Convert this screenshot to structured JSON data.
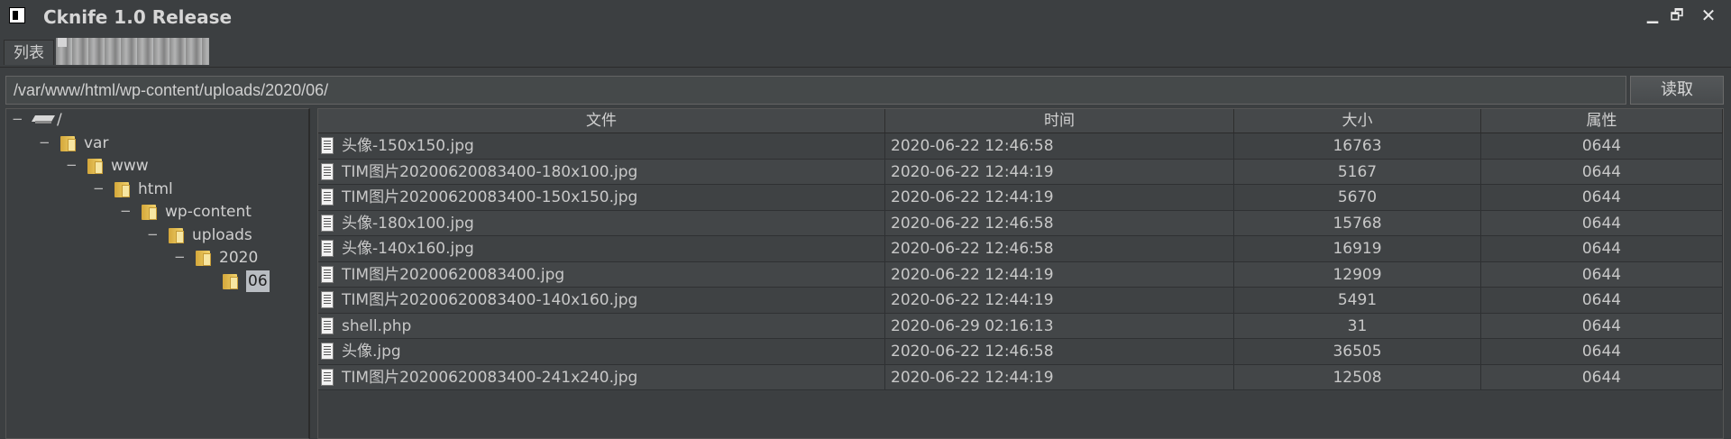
{
  "window": {
    "title": "Cknife 1.0 Release",
    "controls": {
      "minimize": "▁",
      "maximize": "🗗",
      "close": "✕"
    }
  },
  "tabs": [
    {
      "label": "列表"
    },
    {
      "label": ""
    }
  ],
  "pathbar": {
    "value": "/var/www/html/wp-content/uploads/2020/06/",
    "read_button": "读取"
  },
  "tree": {
    "nodes": [
      {
        "label": "/",
        "icon": "drive-icon",
        "toggle": "−",
        "depth": 0
      },
      {
        "label": "var",
        "icon": "folder-icon",
        "toggle": "−",
        "depth": 1
      },
      {
        "label": "www",
        "icon": "folder-icon",
        "toggle": "−",
        "depth": 2
      },
      {
        "label": "html",
        "icon": "folder-icon",
        "toggle": "−",
        "depth": 3
      },
      {
        "label": "wp-content",
        "icon": "folder-icon",
        "toggle": "−",
        "depth": 4
      },
      {
        "label": "uploads",
        "icon": "folder-icon",
        "toggle": "−",
        "depth": 5
      },
      {
        "label": "2020",
        "icon": "folder-icon",
        "toggle": "−",
        "depth": 6
      },
      {
        "label": "06",
        "icon": "folder-icon",
        "toggle": "",
        "depth": 7,
        "selected": true
      }
    ]
  },
  "table": {
    "headers": {
      "name": "文件",
      "time": "时间",
      "size": "大小",
      "attr": "属性"
    },
    "rows": [
      {
        "name": "头像-150x150.jpg",
        "time": "2020-06-22 12:46:58",
        "size": "16763",
        "attr": "0644"
      },
      {
        "name": "TIM图片20200620083400-180x100.jpg",
        "time": "2020-06-22 12:44:19",
        "size": "5167",
        "attr": "0644"
      },
      {
        "name": "TIM图片20200620083400-150x150.jpg",
        "time": "2020-06-22 12:44:19",
        "size": "5670",
        "attr": "0644"
      },
      {
        "name": "头像-180x100.jpg",
        "time": "2020-06-22 12:46:58",
        "size": "15768",
        "attr": "0644"
      },
      {
        "name": "头像-140x160.jpg",
        "time": "2020-06-22 12:46:58",
        "size": "16919",
        "attr": "0644"
      },
      {
        "name": "TIM图片20200620083400.jpg",
        "time": "2020-06-22 12:44:19",
        "size": "12909",
        "attr": "0644"
      },
      {
        "name": "TIM图片20200620083400-140x160.jpg",
        "time": "2020-06-22 12:44:19",
        "size": "5491",
        "attr": "0644"
      },
      {
        "name": "shell.php",
        "time": "2020-06-29 02:16:13",
        "size": "31",
        "attr": "0644"
      },
      {
        "name": "头像.jpg",
        "time": "2020-06-22 12:46:58",
        "size": "36505",
        "attr": "0644"
      },
      {
        "name": "TIM图片20200620083400-241x240.jpg",
        "time": "2020-06-22 12:44:19",
        "size": "12508",
        "attr": "0644"
      }
    ]
  }
}
